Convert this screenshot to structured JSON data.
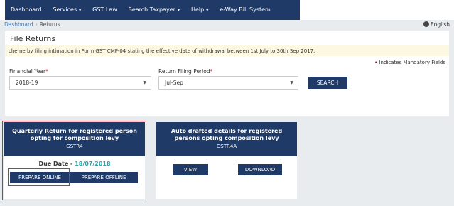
{
  "nav": {
    "items": [
      {
        "label": "Dashboard",
        "dropdown": false
      },
      {
        "label": "Services",
        "dropdown": true
      },
      {
        "label": "GST Law",
        "dropdown": false
      },
      {
        "label": "Search Taxpayer",
        "dropdown": true
      },
      {
        "label": "Help",
        "dropdown": true
      },
      {
        "label": "e-Way Bill System",
        "dropdown": false
      }
    ],
    "caret": "▾"
  },
  "breadcrumb": {
    "home": "Dashboard",
    "separator": "›",
    "current": "Returns"
  },
  "language": {
    "label": "English",
    "icon": "globe-icon"
  },
  "page": {
    "title": "File Returns",
    "notice": "cheme by filing intimation in Form GST CMP-04 stating the effective date of withdrawal between 1st July to 30th Sep 2017.",
    "mandatory_star": "•",
    "mandatory_label": "Indicates Mandatory Fields"
  },
  "form": {
    "financial_year": {
      "label": "Financial Year",
      "required_mark": "*",
      "value": "2018-19"
    },
    "period": {
      "label": "Return Filing Period",
      "required_mark": "*",
      "value": "Jul-Sep"
    },
    "select_arrow": "▼",
    "search_label": "SEARCH"
  },
  "cards": [
    {
      "title": "Quarterly Return for registered person opting for composition levy",
      "form": "GSTR4",
      "due_label": "Due Date -",
      "due_date": "18/07/2018",
      "btn_online": "PREPARE ONLINE",
      "btn_offline": "PREPARE OFFLINE"
    },
    {
      "title": "Auto drafted details for registered persons opting composition levy",
      "form": "GSTR4A",
      "btn_view": "VIEW",
      "btn_download": "DOWNLOAD"
    }
  ],
  "colors": {
    "navy": "#1f3a66",
    "highlight": "#e2232a",
    "due_date": "#2aa1a5",
    "notice_bg": "#fdf8e1",
    "link": "#3a7cc0"
  }
}
